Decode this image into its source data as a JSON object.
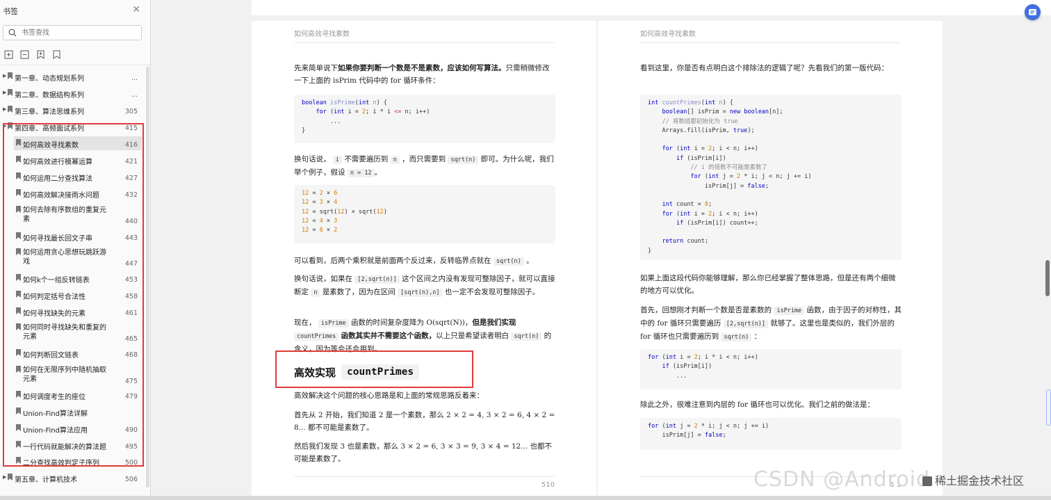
{
  "sidebar": {
    "title": "书签",
    "search_placeholder": "书签查找",
    "bookmarks": [
      {
        "label": "第一章、动态规划系列",
        "page": "...",
        "level": 0
      },
      {
        "label": "第二章、数据结构系列",
        "page": "...",
        "level": 0
      },
      {
        "label": "第三章、算法思维系列",
        "page": "305",
        "level": 0
      },
      {
        "label": "第四章、高频面试系列",
        "page": "415",
        "level": 0
      },
      {
        "label": "如何高效寻找素数",
        "page": "416",
        "level": 1
      },
      {
        "label": "如何高效进行模幂运算",
        "page": "421",
        "level": 1
      },
      {
        "label": "如何运用二分查找算法",
        "page": "427",
        "level": 1
      },
      {
        "label": "如何高效解决接雨水问题",
        "page": "432",
        "level": 1
      },
      {
        "label": "如何去除有序数组的重复元素",
        "page": "440",
        "level": 1
      },
      {
        "label": "如何寻找最长回文子串",
        "page": "443",
        "level": 1
      },
      {
        "label": "如何运用贪心思想玩跳跃游戏",
        "page": "447",
        "level": 1
      },
      {
        "label": "如何k个一组反转链表",
        "page": "453",
        "level": 1
      },
      {
        "label": "如何判定括号合法性",
        "page": "458",
        "level": 1
      },
      {
        "label": "如何寻找缺失的元素",
        "page": "461",
        "level": 1
      },
      {
        "label": "如何同时寻找缺失和重复的元素",
        "page": "465",
        "level": 1
      },
      {
        "label": "如何判断回文链表",
        "page": "468",
        "level": 1
      },
      {
        "label": "如何在无限序列中随机抽取元素",
        "page": "475",
        "level": 1
      },
      {
        "label": "如何调度考生的座位",
        "page": "479",
        "level": 1
      },
      {
        "label": "Union-Find算法详解",
        "page": "",
        "level": 1
      },
      {
        "label": "Union-Find算法应用",
        "page": "490",
        "level": 1
      },
      {
        "label": "一行代码就能解决的算法题",
        "page": "495",
        "level": 1
      },
      {
        "label": "二分查找高效判定子序列",
        "page": "500",
        "level": 1
      },
      {
        "label": "第五章、计算机技术",
        "page": "506",
        "level": 0
      }
    ]
  },
  "left_page": {
    "header": "如何高效寻找素数",
    "p1_a": "先来简单说下",
    "p1_bold": "如果你要判断一个数是不是素数，应该如何写算法。",
    "p1_b": "只需稍微修改一下上面的 isPrim 代码中的 for 循环条件：",
    "p2_a": "换句话说，",
    "p2_c1": "i",
    "p2_b": "不需要遍历到",
    "p2_c2": "n",
    "p2_c": "，而只需要到",
    "p2_c3": "sqrt(n)",
    "p2_d": "即可。为什么呢，我们举个例子，假设",
    "p2_c4": "n = 12",
    "p2_e": "。",
    "p3_a": "可以看到，后两个乘积就是前面两个反过来，反转临界点就在",
    "p3_c1": "sqrt(n)",
    "p3_b": "。",
    "p4_a": "换句话说，如果在",
    "p4_c1": "[2,sqrt(n)]",
    "p4_b": "这个区间之内没有发现可整除因子，就可以直接断定",
    "p4_c2": "n",
    "p4_c": "是素数了，因为在区间",
    "p4_c3": "[sqrt(n),n]",
    "p4_d": "也一定不会发现可整除因子。",
    "p5_a": "现在，",
    "p5_c1": "isPrime",
    "p5_b": "函数的时间复杂度降为 O(sqrt(N))，",
    "p5_bold1": "但是我们实现",
    "p5_c2": "countPrimes",
    "p5_bold2": "函数其实并不需要这个函数，",
    "p5_c": "以上只是希望读者明白",
    "p5_c3": "sqrt(n)",
    "p5_d": "的含义，因为等会还会用到。",
    "heading": "高效实现",
    "heading_code": "countPrimes",
    "p6": "高效解决这个问题的核心思路是和上面的常规思路反着来：",
    "p7": "首先从 2 开始，我们知道 2 是一个素数，那么 2 × 2 = 4, 3 × 2 = 6, 4 × 2 = 8... 都不可能是素数了。",
    "p8": "然后我们发现 3 也是素数，那么 3 × 2 = 6, 3 × 3 = 9, 3 × 4 = 12... 也都不可能是素数了。",
    "page_number": "510"
  },
  "right_page": {
    "header": "如何高效寻找素数",
    "p1": "看到这里，你是否有点明白这个排除法的逻辑了呢？先看我们的第一版代码：",
    "p2": "如果上面这段代码你能够理解，那么你已经掌握了整体思路，但是还有两个细微的地方可以优化。",
    "p3_a": "首先，回想刚才判断一个数是否是素数的",
    "p3_c1": "isPrime",
    "p3_b": "函数，由于因子的对称性，其中的 for 循环只需要遍历",
    "p3_c2": "[2,sqrt(n)]",
    "p3_c": "就够了。这里也是类似的，我们外层的 for 循环也只需要遍历到",
    "p3_c3": "sqrt(n)",
    "p3_d": "：",
    "p4": "除此之外，很难注意到内层的 for 循环也可以优化。我们之前的做法是：",
    "page_number": "5 1"
  },
  "watermark": {
    "text": "CSDN @Android",
    "brand": "稀土掘金技术社区"
  },
  "colors": {
    "highlight_red": "#e03a3a",
    "code_keyword": "#0000c2",
    "code_number": "#d17b00",
    "fab_blue": "#3f6fe0"
  }
}
